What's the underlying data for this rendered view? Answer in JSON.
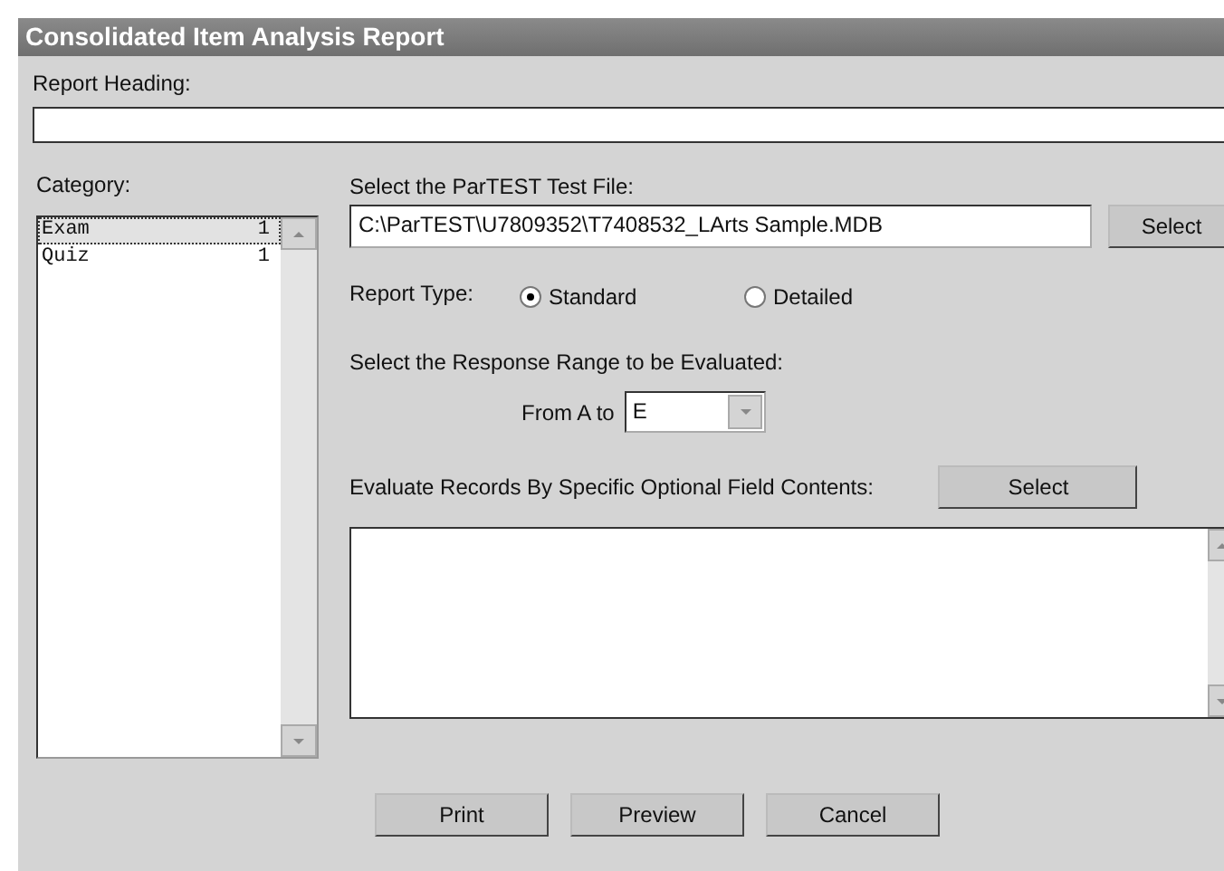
{
  "window": {
    "title": "Consolidated Item Analysis Report"
  },
  "report_heading": {
    "label": "Report Heading:"
  },
  "category": {
    "label": "Category:",
    "items": [
      {
        "name": "Exam",
        "count": "1",
        "selected": true
      },
      {
        "name": "Quiz",
        "count": "1",
        "selected": false
      }
    ]
  },
  "test_file": {
    "label": "Select the ParTEST Test File:",
    "value": "C:\\ParTEST\\U7809352\\T7408532_LArts Sample.MDB",
    "button": "Select"
  },
  "report_type": {
    "label": "Report Type:",
    "options": [
      {
        "label": "Standard",
        "selected": true
      },
      {
        "label": "Detailed",
        "selected": false
      }
    ]
  },
  "response_range": {
    "label": "Select the Response Range to be Evaluated:",
    "from_label": "From A to",
    "value": "E"
  },
  "optional_fields": {
    "label": "Evaluate Records By Specific Optional Field Contents:",
    "button": "Select"
  },
  "buttons": [
    "Print",
    "Preview",
    "Cancel"
  ]
}
